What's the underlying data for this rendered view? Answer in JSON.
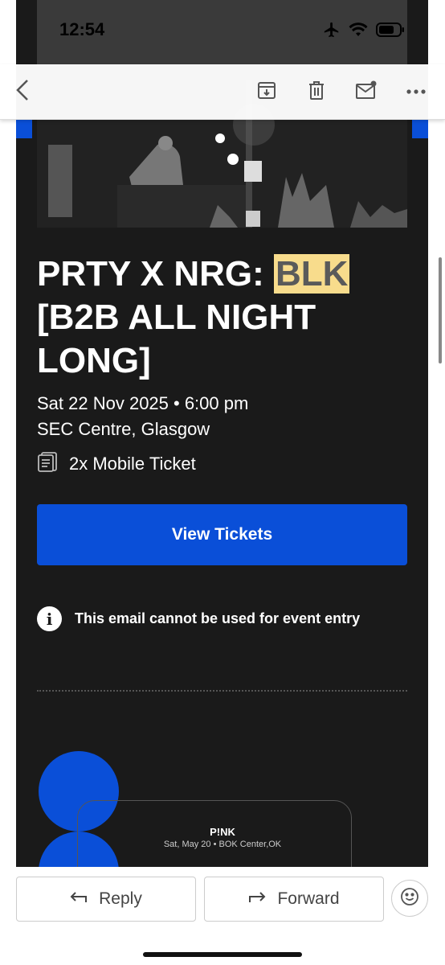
{
  "status_bar": {
    "time": "12:54"
  },
  "event": {
    "title_prefix": "PRTY X NRG: ",
    "title_highlight": "BLK",
    "title_suffix": " [B2B ALL NIGHT LONG]",
    "datetime": "Sat 22 Nov 2025 • 6:00 pm",
    "venue": "SEC Centre, Glasgow",
    "tickets": "2x Mobile Ticket"
  },
  "view_tickets_label": "View Tickets",
  "entry_notice": "This email cannot be used for event entry",
  "promo": {
    "name": "P!NK",
    "details": "Sat, May 20 • BOK Center,OK"
  },
  "actions": {
    "reply": "Reply",
    "forward": "Forward"
  },
  "colors": {
    "accent": "#0a4fd8",
    "card_bg": "#1a1a1a",
    "highlight": "#f8dc8c"
  }
}
